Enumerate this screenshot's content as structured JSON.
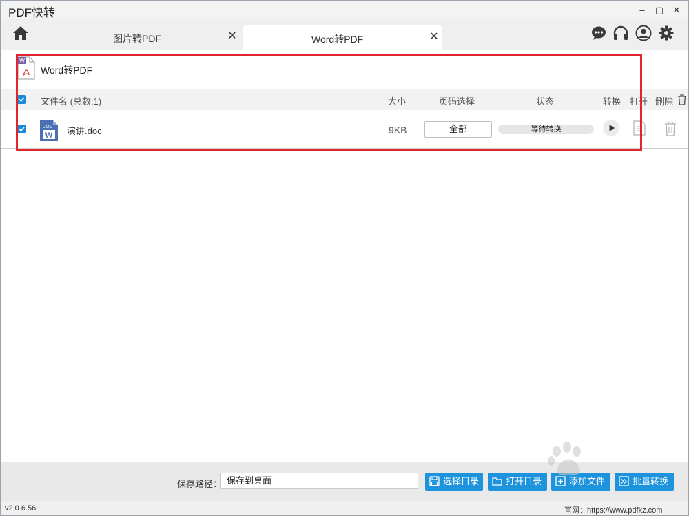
{
  "window": {
    "title": "PDF快转",
    "minimize": "–",
    "maximize": "▢",
    "close": "✕"
  },
  "tabs": [
    {
      "label": "图片转PDF",
      "close": "✕",
      "active": false
    },
    {
      "label": "Word转PDF",
      "close": "✕",
      "active": true
    }
  ],
  "toolbar_icons": [
    "chat-icon",
    "headset-icon",
    "user-icon",
    "gear-icon"
  ],
  "section": {
    "title": "Word转PDF"
  },
  "table": {
    "columns": {
      "filename": "文件名 (总数:1)",
      "size": "大小",
      "page_select": "页码选择",
      "status": "状态",
      "convert": "转换",
      "open": "打开",
      "delete": "删除"
    },
    "rows": [
      {
        "name": "演讲.doc",
        "size": "9KB",
        "pages": "全部",
        "status": "等待转换",
        "checked": true
      }
    ]
  },
  "footer": {
    "save_path_label": "保存路径：",
    "save_path_value": "保存到桌面",
    "buttons": {
      "choose_dir": "选择目录",
      "open_dir": "打开目录",
      "add_file": "添加文件",
      "batch_convert": "批量转换"
    },
    "version": "v2.0.6.56",
    "website": "官网：https://www.pdfkz.com"
  },
  "colors": {
    "accent": "#1e93dd",
    "highlight_frame": "#e0262c",
    "word_purple": "#7b5ea7"
  }
}
